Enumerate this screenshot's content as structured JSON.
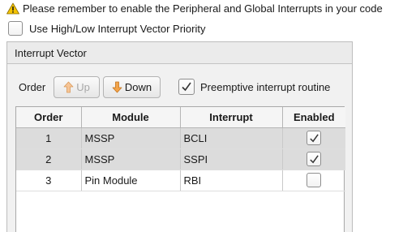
{
  "warning": {
    "icon": "warning-icon",
    "text": "Please remember to enable the Peripheral and Global Interrupts in your code"
  },
  "vector_priority": {
    "label": "Use High/Low Interrupt Vector Priority",
    "checked": false
  },
  "panel": {
    "title": "Interrupt Vector",
    "order_label": "Order",
    "up_label": "Up",
    "down_label": "Down",
    "preemptive_label": "Preemptive interrupt routine",
    "preemptive_checked": true
  },
  "table": {
    "headers": [
      "Order",
      "Module",
      "Interrupt",
      "Enabled"
    ],
    "rows": [
      {
        "order": "1",
        "module": "MSSP",
        "interrupt": "BCLI",
        "enabled": true
      },
      {
        "order": "2",
        "module": "MSSP",
        "interrupt": "SSPI",
        "enabled": true
      },
      {
        "order": "3",
        "module": "Pin Module",
        "interrupt": "RBI",
        "enabled": false
      }
    ]
  },
  "colors": {
    "warning_fill": "#f5c400",
    "arrow_fill": "#f3a44a",
    "selected_row": "#dcdcdc"
  }
}
